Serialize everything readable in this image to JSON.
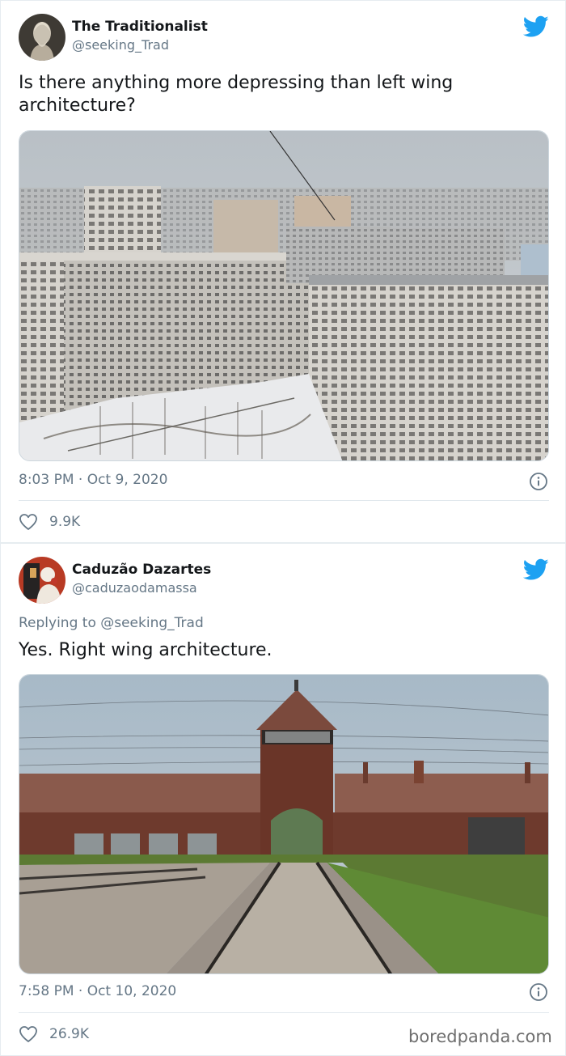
{
  "tweets": [
    {
      "author": {
        "name": "The Traditionalist",
        "handle": "@seeking_Trad",
        "avatar_icon": "statue-bust-avatar"
      },
      "text": "Is there anything more depressing than left wing architecture?",
      "media": {
        "subject": "soviet-apartment-blocks-photo"
      },
      "timestamp": "8:03 PM · Oct 9, 2020",
      "likes": "9.9K"
    },
    {
      "author": {
        "name": "Caduzão Dazartes",
        "handle": "@caduzaodamassa",
        "avatar_icon": "pirate-avatar"
      },
      "replying_to": "Replying to @seeking_Trad",
      "text": "Yes. Right wing architecture.",
      "media": {
        "subject": "railway-gate-building-photo"
      },
      "timestamp": "7:58 PM · Oct 10, 2020",
      "likes": "26.9K"
    }
  ],
  "watermark": "boredpanda.com",
  "colors": {
    "twitter_blue": "#1da1f2",
    "secondary_text": "#657786",
    "primary_text": "#14171a"
  }
}
